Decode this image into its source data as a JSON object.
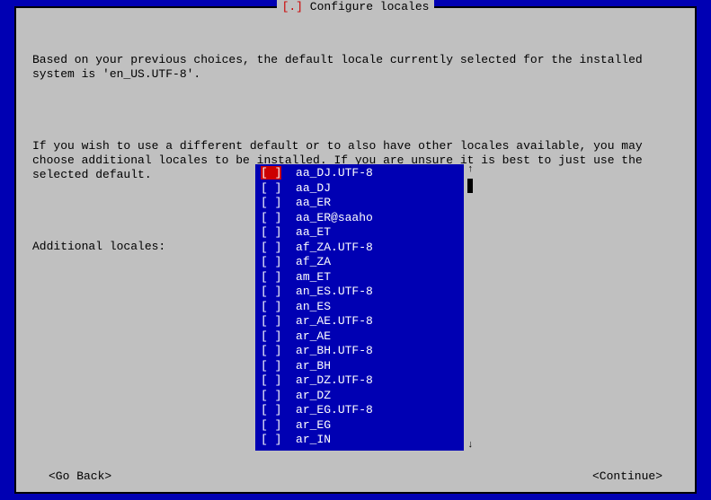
{
  "title": {
    "prefix": "[.]",
    "text": "Configure locales"
  },
  "body": {
    "para1": "Based on your previous choices, the default locale currently selected for the installed system is 'en_US.UTF-8'.",
    "para2": "If you wish to use a different default or to also have other locales available, you may choose additional locales to be installed. If you are unsure it is best to just use the selected default.",
    "list_label": "Additional locales:"
  },
  "locales": [
    "aa_DJ.UTF-8",
    "aa_DJ",
    "aa_ER",
    "aa_ER@saaho",
    "aa_ET",
    "af_ZA.UTF-8",
    "af_ZA",
    "am_ET",
    "an_ES.UTF-8",
    "an_ES",
    "ar_AE.UTF-8",
    "ar_AE",
    "ar_BH.UTF-8",
    "ar_BH",
    "ar_DZ.UTF-8",
    "ar_DZ",
    "ar_EG.UTF-8",
    "ar_EG",
    "ar_IN"
  ],
  "selected_index": 0,
  "buttons": {
    "back": "<Go Back>",
    "continue": "<Continue>"
  },
  "scroll": {
    "up": "↑",
    "down": "↓"
  }
}
